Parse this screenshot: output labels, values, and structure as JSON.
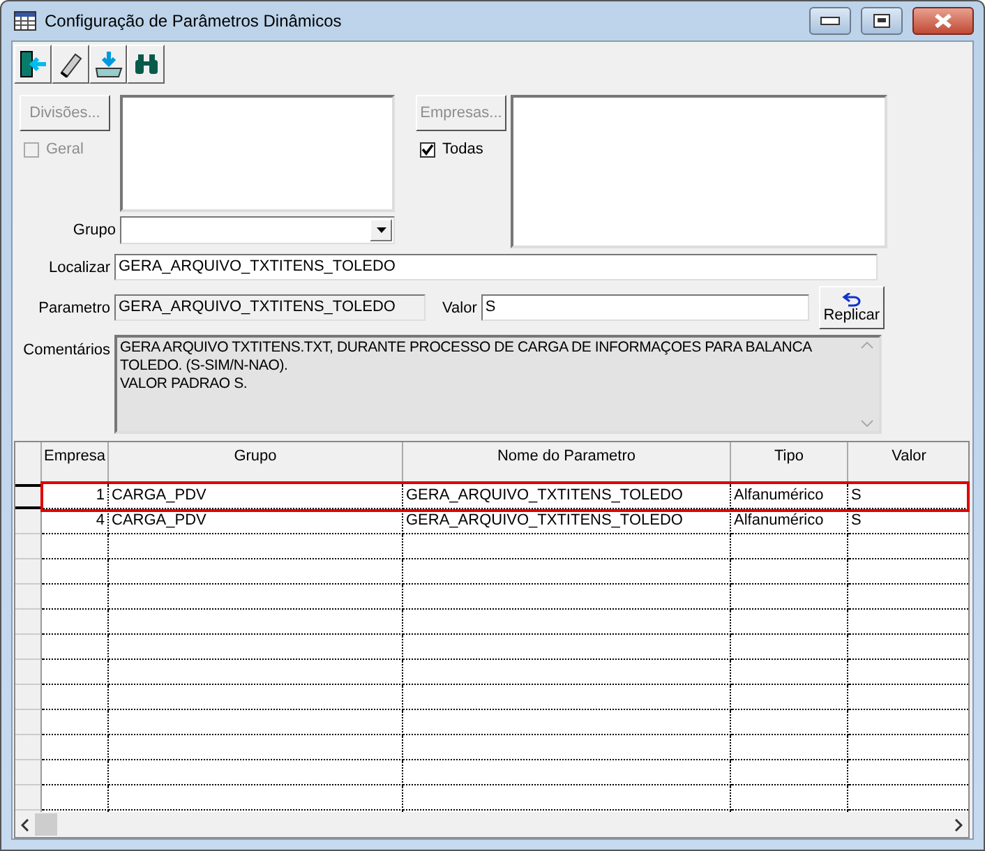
{
  "window": {
    "title": "Configuração de Parâmetros Dinâmicos"
  },
  "divisions": {
    "button": "Divisões...",
    "disabled": true,
    "general": {
      "label": "Geral",
      "checked": false,
      "disabled": true
    }
  },
  "companies": {
    "button": "Empresas...",
    "disabled": true,
    "all": {
      "label": "Todas",
      "checked": true,
      "disabled": false
    }
  },
  "group": {
    "label": "Grupo"
  },
  "search": {
    "label": "Localizar",
    "value": "GERA_ARQUIVO_TXTITENS_TOLEDO"
  },
  "parameter": {
    "label": "Parametro",
    "value": "GERA_ARQUIVO_TXTITENS_TOLEDO"
  },
  "value": {
    "label": "Valor",
    "value": "S"
  },
  "replicate_button": "Replicar",
  "comments": {
    "label": "Comentários",
    "value": "GERA ARQUIVO TXTITENS.TXT, DURANTE PROCESSO DE CARGA DE INFORMAÇOES PARA BALANCA TOLEDO. (S-SIM/N-NAO).\nVALOR PADRAO S."
  },
  "table": {
    "columns": [
      "Empresa",
      "Grupo",
      "Nome do Parametro",
      "Tipo",
      "Valor"
    ],
    "rows": [
      {
        "cells": [
          "1",
          "CARGA_PDV",
          "GERA_ARQUIVO_TXTITENS_TOLEDO",
          "Alfanumérico",
          "S"
        ],
        "selected": true
      },
      {
        "cells": [
          "4",
          "CARGA_PDV",
          "GERA_ARQUIVO_TXTITENS_TOLEDO",
          "Alfanumérico",
          "S"
        ],
        "selected": false
      }
    ]
  }
}
